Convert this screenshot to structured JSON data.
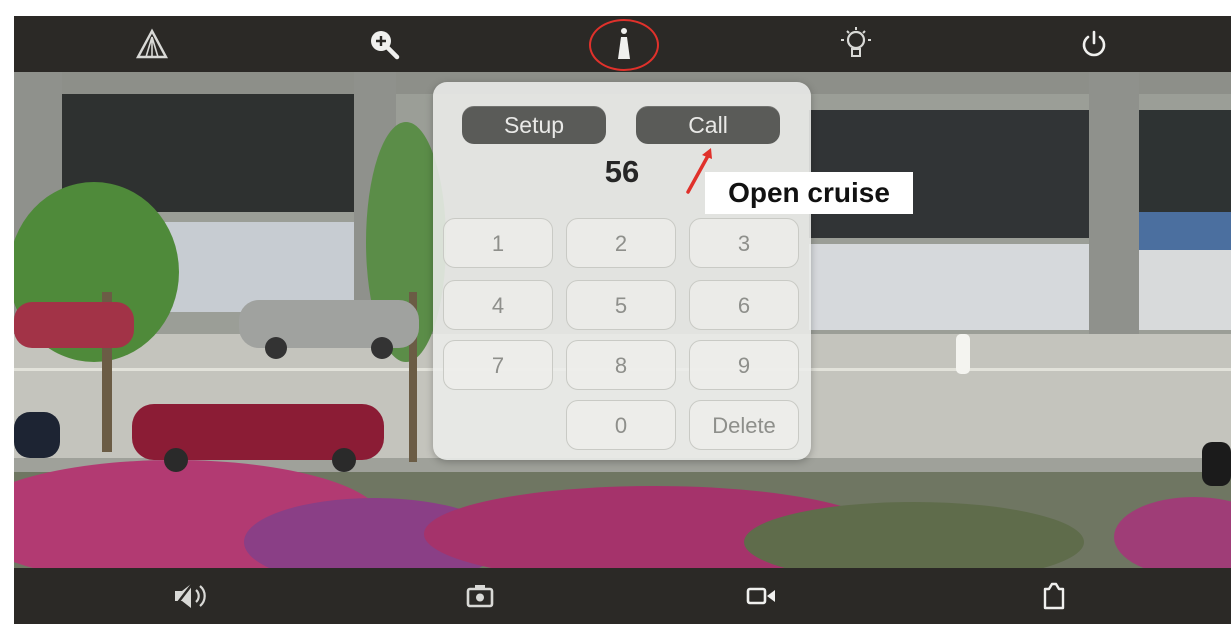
{
  "toolbar_top": {
    "icons": [
      "warning-triangle-icon",
      "zoom-in-icon",
      "wiper-icon",
      "light-bulb-icon",
      "power-icon"
    ]
  },
  "toolbar_bottom": {
    "icons": [
      "speaker-icon",
      "snapshot-icon",
      "record-icon",
      "rotate-icon"
    ]
  },
  "keypad": {
    "setup_label": "Setup",
    "call_label": "Call",
    "preset_value": "56",
    "keys": [
      "1",
      "2",
      "3",
      "4",
      "5",
      "6",
      "7",
      "8",
      "9",
      "0",
      "Delete"
    ]
  },
  "annotation": {
    "text": "Open cruise",
    "color": "#e0312b"
  },
  "colors": {
    "bar": "#2b2926",
    "pill": "#5a5b58"
  }
}
